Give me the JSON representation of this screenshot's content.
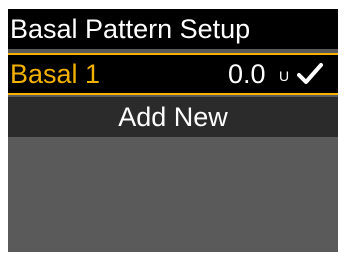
{
  "header": {
    "title": "Basal Pattern Setup"
  },
  "patterns": [
    {
      "name": "Basal 1",
      "amount": "0.0",
      "unit": "U",
      "active_icon": "checkmark-icon"
    }
  ],
  "actions": {
    "add_new_label": "Add New"
  },
  "colors": {
    "accent": "#f2b100",
    "title_background": "#000000",
    "row_background": "#2b2b2b",
    "empty_background": "#5a5a5a",
    "text": "#ffffff"
  }
}
